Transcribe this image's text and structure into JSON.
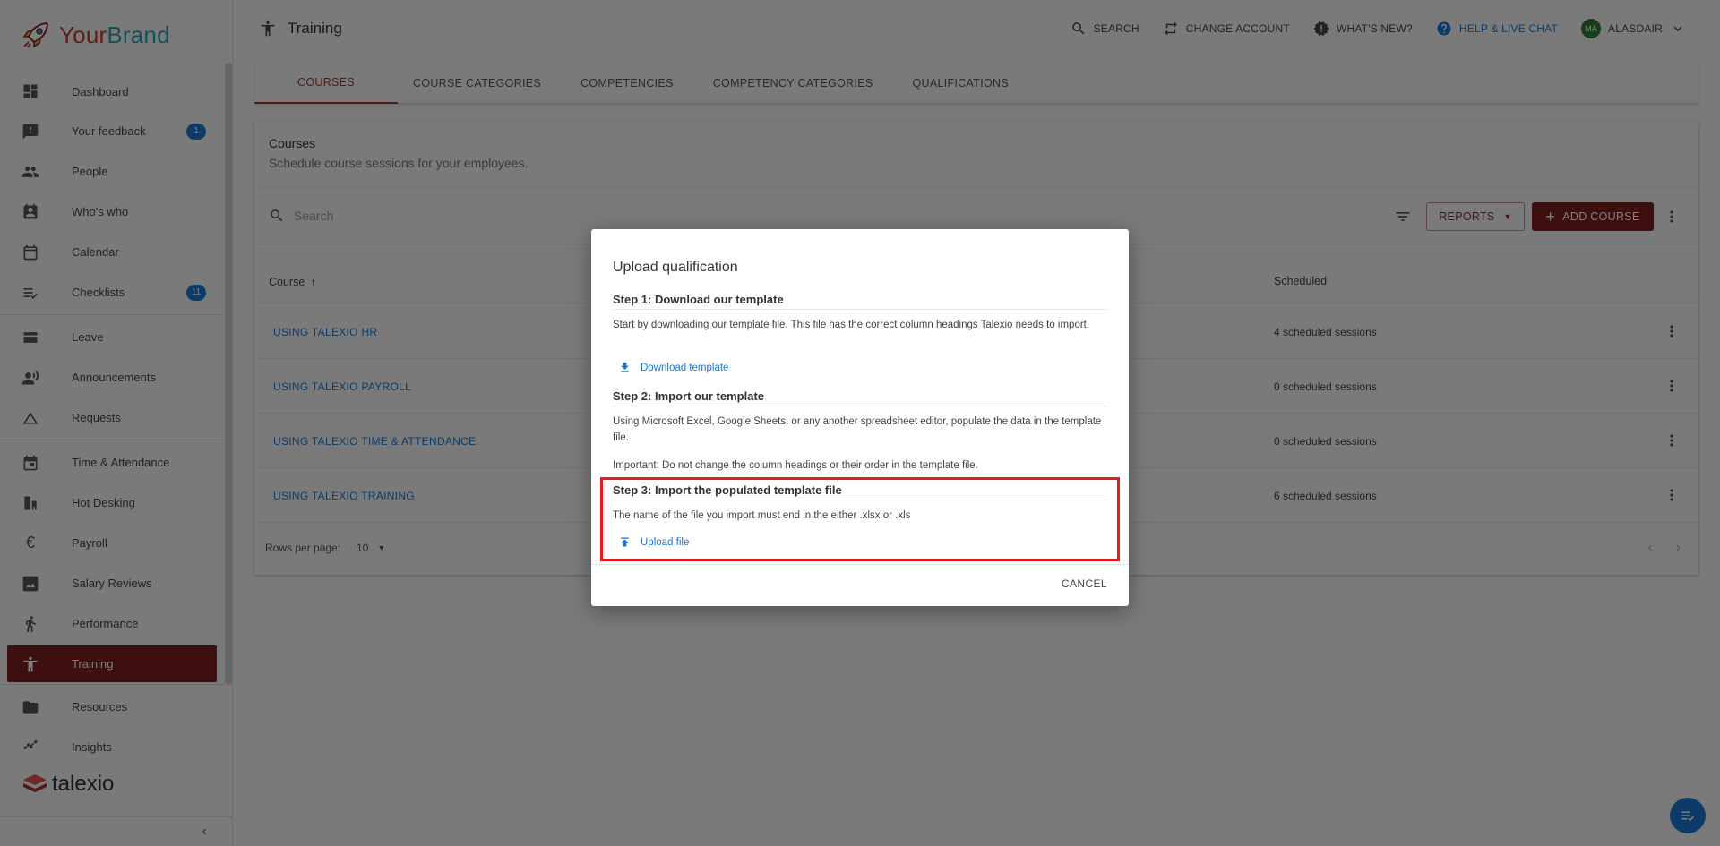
{
  "brand": {
    "your": "Your",
    "name": "Brand",
    "footer": "talexio"
  },
  "sidebar": {
    "groups": [
      [
        {
          "label": "Dashboard",
          "icon": "dashboard-icon"
        },
        {
          "label": "Your feedback",
          "icon": "feedback-icon",
          "badge": "1"
        },
        {
          "label": "People",
          "icon": "people-icon"
        },
        {
          "label": "Who's who",
          "icon": "contact-icon"
        },
        {
          "label": "Calendar",
          "icon": "calendar-icon"
        },
        {
          "label": "Checklists",
          "icon": "checklist-icon",
          "badge": "11"
        }
      ],
      [
        {
          "label": "Leave",
          "icon": "leave-icon"
        },
        {
          "label": "Announcements",
          "icon": "announcement-icon"
        },
        {
          "label": "Requests",
          "icon": "requests-icon"
        }
      ],
      [
        {
          "label": "Time & Attendance",
          "icon": "time-icon"
        },
        {
          "label": "Hot Desking",
          "icon": "desk-icon"
        },
        {
          "label": "Payroll",
          "icon": "euro-icon"
        },
        {
          "label": "Salary Reviews",
          "icon": "salary-icon"
        },
        {
          "label": "Performance",
          "icon": "run-icon"
        },
        {
          "label": "Training",
          "icon": "accessibility-icon",
          "active": true
        }
      ],
      [
        {
          "label": "Resources",
          "icon": "folder-icon"
        },
        {
          "label": "Insights",
          "icon": "insights-icon"
        }
      ]
    ],
    "collapse": "‹"
  },
  "header": {
    "title": "Training",
    "search": "SEARCH",
    "change_account": "CHANGE ACCOUNT",
    "whats_new": "WHAT'S NEW?",
    "help": "HELP & LIVE CHAT",
    "avatar": "MA",
    "user": "ALASDAIR"
  },
  "tabs": [
    "COURSES",
    "COURSE CATEGORIES",
    "COMPETENCIES",
    "COMPETENCY CATEGORIES",
    "QUALIFICATIONS"
  ],
  "card": {
    "title": "Courses",
    "subtitle": "Schedule course sessions for your employees.",
    "search_placeholder": "Search",
    "reports": "REPORTS",
    "add_course": "ADD COURSE",
    "col_course": "Course",
    "col_scheduled": "Scheduled",
    "rows": [
      {
        "name": "USING TALEXIO HR",
        "scheduled": "4 scheduled sessions"
      },
      {
        "name": "USING TALEXIO PAYROLL",
        "scheduled": "0 scheduled sessions"
      },
      {
        "name": "USING TALEXIO TIME & ATTENDANCE",
        "scheduled": "0 scheduled sessions"
      },
      {
        "name": "USING TALEXIO TRAINING",
        "scheduled": "6 scheduled sessions"
      }
    ],
    "rows_per_page_label": "Rows per page:",
    "rows_per_page": "10"
  },
  "dialog": {
    "title": "Upload qualification",
    "step1_title": "Step 1: Download our template",
    "step1_text": "Start by downloading our template file. This file has the correct column headings Talexio needs to import.",
    "download_link": "Download template",
    "step2_title": "Step 2: Import our template",
    "step2_text": "Using Microsoft Excel, Google Sheets, or any another spreadsheet editor, populate the data in the template file.",
    "important": "Important: Do not change the column headings or their order in the template file.",
    "step3_title": "Step 3: Import the populated template file",
    "step3_text": "The name of the file you import must end in the either .xlsx or .xls",
    "upload_link": "Upload file",
    "cancel": "CANCEL"
  },
  "colors": {
    "accent": "#7a1f1f",
    "link": "#1976d2",
    "highlight": "#e21b1b"
  }
}
